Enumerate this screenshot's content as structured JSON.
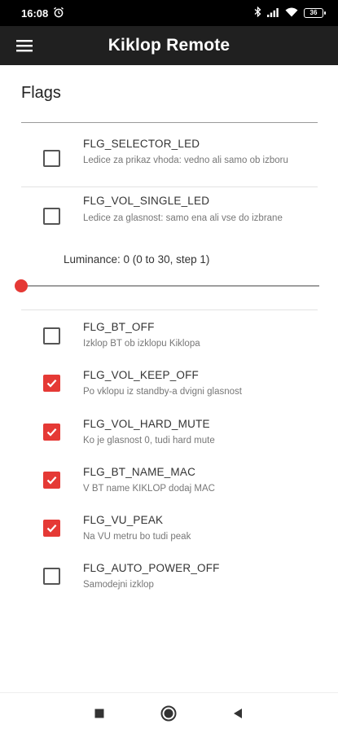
{
  "status_bar": {
    "time": "16:08",
    "battery": "36"
  },
  "app_bar": {
    "title": "Kiklop Remote",
    "menu_icon": "hamburger-menu-icon"
  },
  "section": {
    "title": "Flags"
  },
  "flags_top": [
    {
      "title": "FLG_SELECTOR_LED",
      "summary": "Ledice za prikaz vhoda: vedno ali samo ob izboru",
      "checked": false
    },
    {
      "title": "FLG_VOL_SINGLE_LED",
      "summary": "Ledice za glasnost: samo ena ali vse do izbrane",
      "checked": false
    }
  ],
  "luminance": {
    "label": "Luminance: 0 (0 to 30, step 1)",
    "value": 0,
    "min": 0,
    "max": 30,
    "step": 1
  },
  "flags_bottom": [
    {
      "title": "FLG_BT_OFF",
      "summary": "Izklop BT ob izklopu Kiklopa",
      "checked": false
    },
    {
      "title": "FLG_VOL_KEEP_OFF",
      "summary": "Po vklopu iz standby-a dvigni glasnost",
      "checked": true
    },
    {
      "title": "FLG_VOL_HARD_MUTE",
      "summary": "Ko je glasnost 0, tudi hard mute",
      "checked": true
    },
    {
      "title": "FLG_BT_NAME_MAC",
      "summary": "V BT name KIKLOP dodaj MAC",
      "checked": true
    },
    {
      "title": "FLG_VU_PEAK",
      "summary": "Na VU metru bo tudi peak",
      "checked": true
    },
    {
      "title": "FLG_AUTO_POWER_OFF",
      "summary": "Samodejni izklop",
      "checked": false
    }
  ],
  "colors": {
    "accent": "#e53935",
    "app_bar": "#202020",
    "status_bar": "#000000"
  },
  "nav_bar": {
    "icons": [
      "recents-square-icon",
      "home-circle-icon",
      "back-triangle-icon"
    ]
  }
}
